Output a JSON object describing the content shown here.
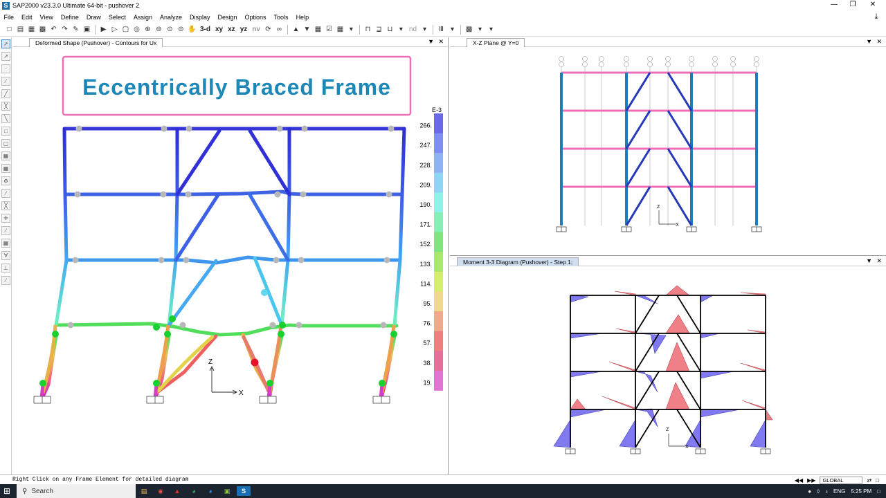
{
  "window": {
    "title": "SAP2000 v23.3.0 Ultimate 64-bit - pushover 2",
    "app_icon": "S"
  },
  "menu": [
    "File",
    "Edit",
    "View",
    "Define",
    "Draw",
    "Select",
    "Assign",
    "Analyze",
    "Display",
    "Design",
    "Options",
    "Tools",
    "Help"
  ],
  "toolbar": {
    "view_buttons": [
      "3-d",
      "xy",
      "xz",
      "yz",
      "nv"
    ],
    "nd_label": "nd"
  },
  "panels": {
    "left": {
      "tab": "Deformed Shape (Pushover) - Contours for Ux",
      "banner": "Eccentrically Braced Frame",
      "axis_z": "Z",
      "axis_x": "X"
    },
    "top_right": {
      "tab": "X-Z Plane @ Y=0"
    },
    "bottom_right": {
      "tab": "Moment 3-3 Diagram (Pushover) - Step 1;"
    }
  },
  "legend": {
    "exponent": "E-3",
    "ticks": [
      "266.",
      "247.",
      "228.",
      "209.",
      "190.",
      "171.",
      "152.",
      "133.",
      "114.",
      "95.",
      "76.",
      "57.",
      "38.",
      "19."
    ],
    "colors": [
      "#6a6ae8",
      "#7f8ef2",
      "#8fb2f7",
      "#8ed6f6",
      "#8df2e8",
      "#85f0b5",
      "#7fe67a",
      "#a8e86a",
      "#d6ee6e",
      "#f2d88a",
      "#f2a98a",
      "#ef7f7f",
      "#e86f9a",
      "#e374d3"
    ]
  },
  "status": {
    "message": "Right Click on any Frame Element for detailed diagram",
    "coord_system": "GLOBAL"
  },
  "taskbar": {
    "search_placeholder": "Search",
    "language": "ENG",
    "time": "5:25 PM"
  }
}
